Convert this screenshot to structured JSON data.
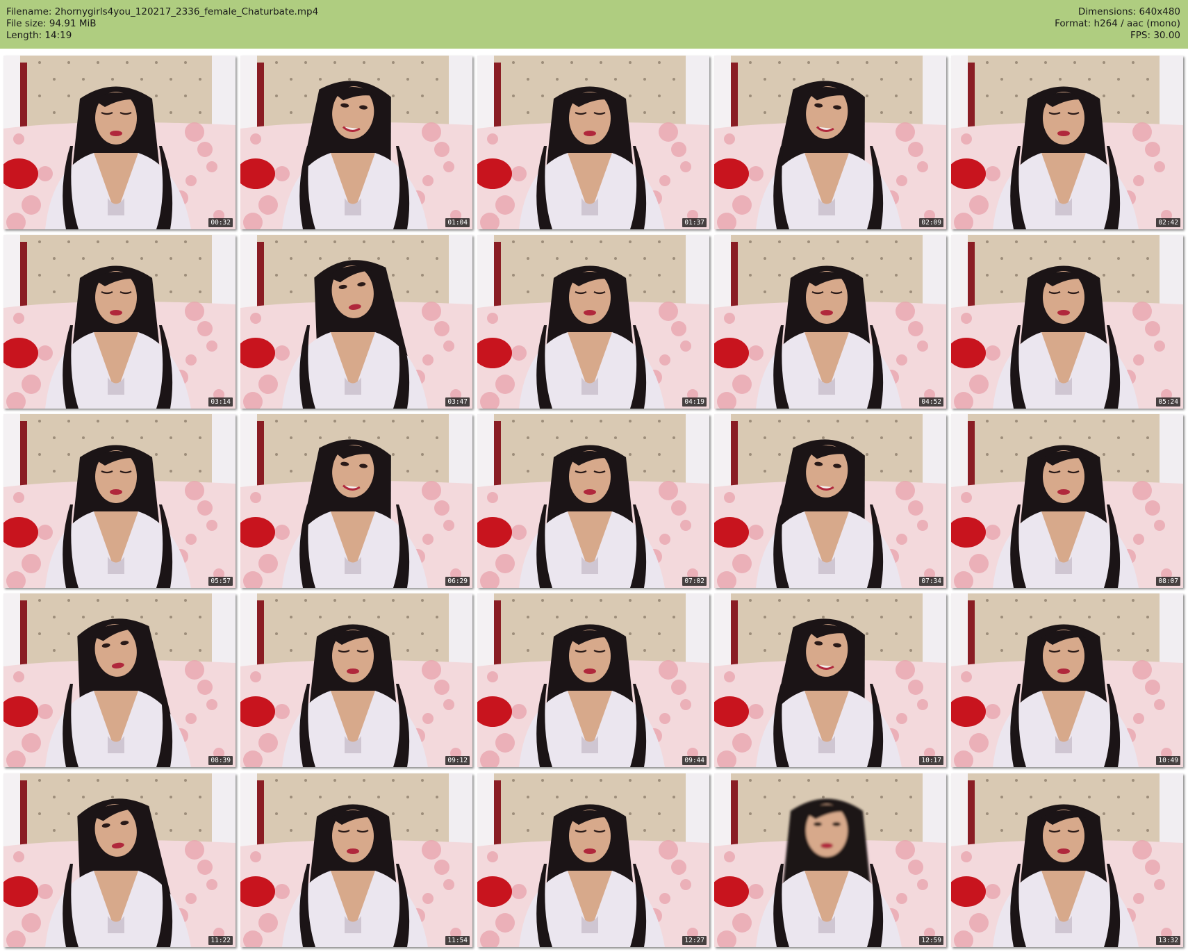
{
  "header": {
    "filename_line": "Filename: 2hornygirls4you_120217_2336_female_Chaturbate.mp4",
    "filesize_line": "File size: 94.91 MiB",
    "length_line": "Length: 14:19",
    "dimensions_line": "Dimensions: 640x480",
    "format_line": "Format: h264 / aac (mono)",
    "fps_line": "FPS: 30.00"
  },
  "colors": {
    "header_bg": "#afcd80",
    "page_bg": "#ffffff",
    "timestamp_bg": "#141414"
  },
  "thumbnails": [
    {
      "timestamp": "00:32",
      "pose": "down"
    },
    {
      "timestamp": "01:04",
      "pose": "smile"
    },
    {
      "timestamp": "01:37",
      "pose": "down"
    },
    {
      "timestamp": "02:09",
      "pose": "smile"
    },
    {
      "timestamp": "02:42",
      "pose": "down"
    },
    {
      "timestamp": "03:14",
      "pose": "down"
    },
    {
      "timestamp": "03:47",
      "pose": "side"
    },
    {
      "timestamp": "04:19",
      "pose": "down"
    },
    {
      "timestamp": "04:52",
      "pose": "down"
    },
    {
      "timestamp": "05:24",
      "pose": "down"
    },
    {
      "timestamp": "05:57",
      "pose": "down"
    },
    {
      "timestamp": "06:29",
      "pose": "smile"
    },
    {
      "timestamp": "07:02",
      "pose": "down"
    },
    {
      "timestamp": "07:34",
      "pose": "smile"
    },
    {
      "timestamp": "08:07",
      "pose": "down"
    },
    {
      "timestamp": "08:39",
      "pose": "side"
    },
    {
      "timestamp": "09:12",
      "pose": "down"
    },
    {
      "timestamp": "09:44",
      "pose": "down"
    },
    {
      "timestamp": "10:17",
      "pose": "smile"
    },
    {
      "timestamp": "10:49",
      "pose": "down"
    },
    {
      "timestamp": "11:22",
      "pose": "side"
    },
    {
      "timestamp": "11:54",
      "pose": "down"
    },
    {
      "timestamp": "12:27",
      "pose": "down"
    },
    {
      "timestamp": "12:59",
      "pose": "blur"
    },
    {
      "timestamp": "13:32",
      "pose": "down"
    }
  ]
}
